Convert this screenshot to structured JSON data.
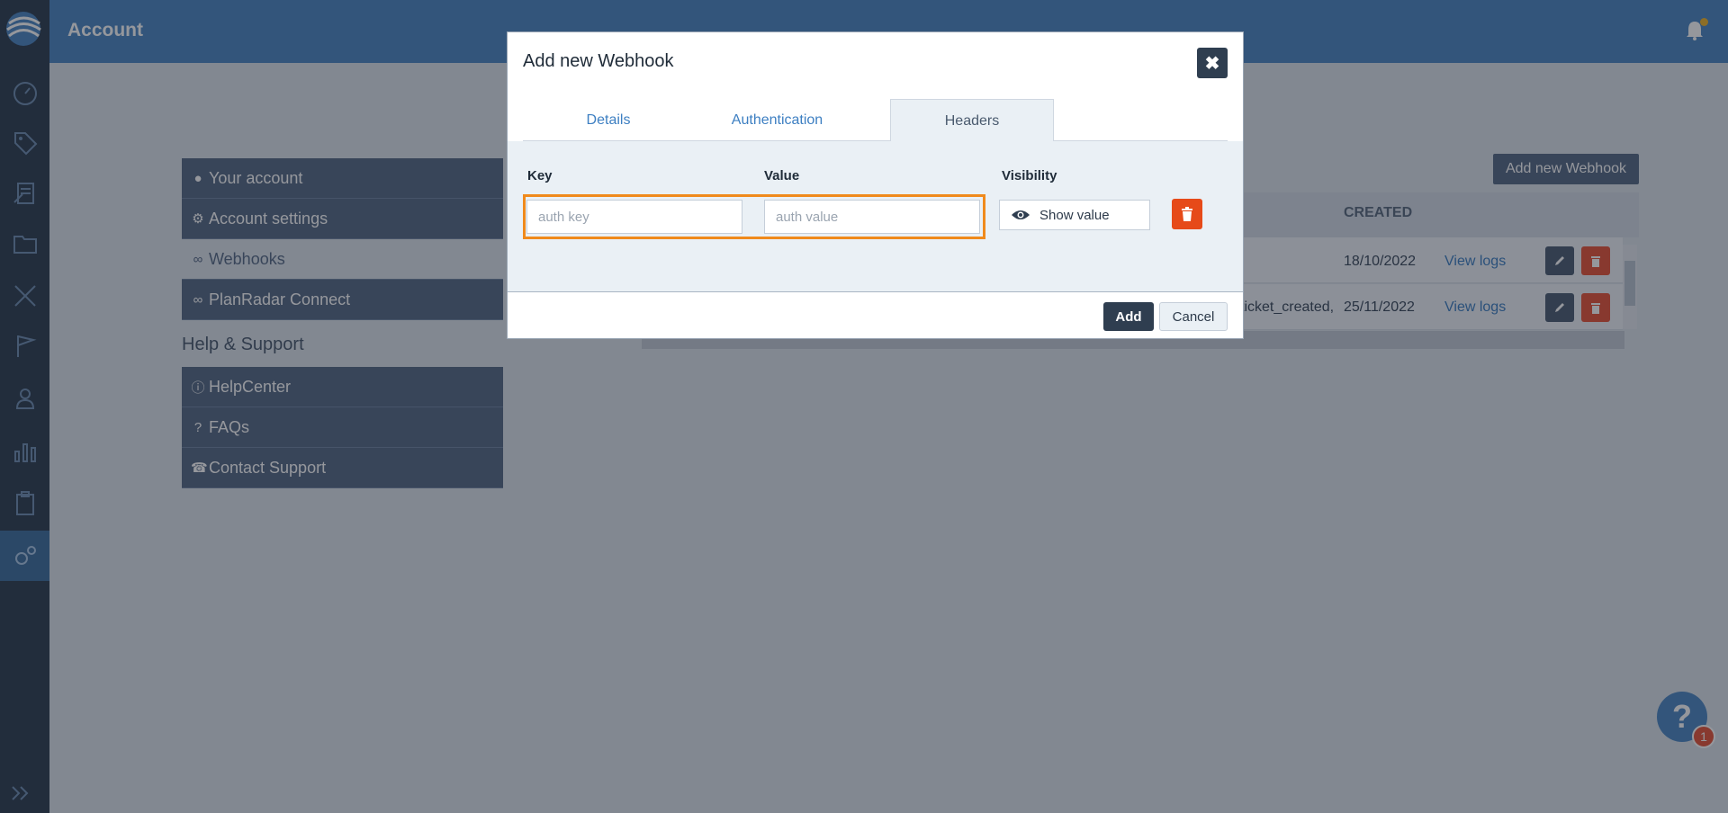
{
  "header": {
    "title": "Account"
  },
  "account_menu": {
    "items": [
      {
        "label": "Your account",
        "icon": "user-icon"
      },
      {
        "label": "Account settings",
        "icon": "gear-icon"
      },
      {
        "label": "Webhooks",
        "icon": "link-icon"
      },
      {
        "label": "PlanRadar Connect",
        "icon": "link-icon"
      }
    ],
    "help_title": "Help & Support",
    "help_items": [
      {
        "label": "HelpCenter",
        "icon": "info-icon"
      },
      {
        "label": "FAQs",
        "icon": "question-icon"
      },
      {
        "label": "Contact Support",
        "icon": "phone-icon"
      }
    ]
  },
  "webhooks_page": {
    "add_button": "Add new Webhook",
    "columns": {
      "created": "CREATED"
    },
    "rows": [
      {
        "events": "",
        "created": "18/10/2022",
        "logs_link": "View logs"
      },
      {
        "events": "ticket_created,",
        "created": "25/11/2022",
        "logs_link": "View logs"
      }
    ]
  },
  "modal": {
    "title": "Add new Webhook",
    "close_icon": "close-icon",
    "tabs": [
      {
        "label": "Details",
        "active": false
      },
      {
        "label": "Authentication",
        "active": false
      },
      {
        "label": "Headers",
        "active": true
      }
    ],
    "headers_form": {
      "key_label": "Key",
      "value_label": "Value",
      "visibility_label": "Visibility",
      "key_placeholder": "auth key",
      "value_placeholder": "auth value",
      "show_value_label": "Show value"
    },
    "footer": {
      "add_label": "Add",
      "cancel_label": "Cancel"
    }
  },
  "help_widget": {
    "icon_text": "?",
    "badge": "1"
  },
  "colors": {
    "accent": "#4d88c4",
    "danger": "#e64a19",
    "highlight": "#f08a1c",
    "dark": "#2f3e50"
  }
}
